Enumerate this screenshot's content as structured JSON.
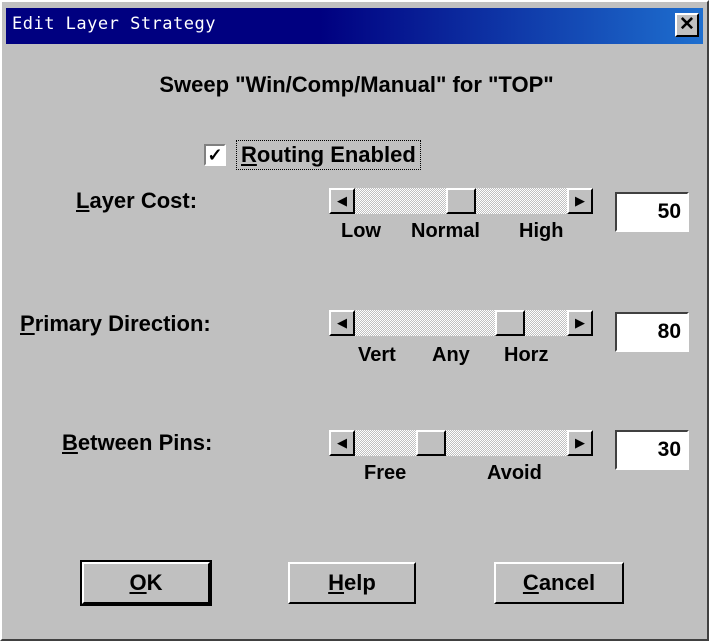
{
  "window": {
    "title": "Edit Layer Strategy",
    "close_glyph": "✕"
  },
  "heading": "Sweep \"Win/Comp/Manual\" for \"TOP\"",
  "routing": {
    "checked": true,
    "check_mark": "✓",
    "mnemonic": "R",
    "label_rest": "outing Enabled"
  },
  "rows": [
    {
      "mnemonic": "L",
      "label_rest": "ayer Cost:",
      "value": "50",
      "ticks": [
        "Low",
        "Normal",
        "High"
      ]
    },
    {
      "mnemonic": "P",
      "label_rest": "rimary Direction:",
      "value": "80",
      "ticks": [
        "Vert",
        "Any",
        "Horz"
      ]
    },
    {
      "mnemonic": "B",
      "label_rest": "etween Pins:",
      "value": "30",
      "ticks": [
        "Free",
        "Avoid"
      ]
    }
  ],
  "scroll_icons": {
    "left": "◀",
    "right": "▶"
  },
  "buttons": {
    "ok": {
      "mnemonic": "O",
      "rest": "K"
    },
    "help": {
      "mnemonic": "H",
      "rest": "elp"
    },
    "cancel": {
      "mnemonic": "C",
      "rest": "ancel"
    }
  }
}
